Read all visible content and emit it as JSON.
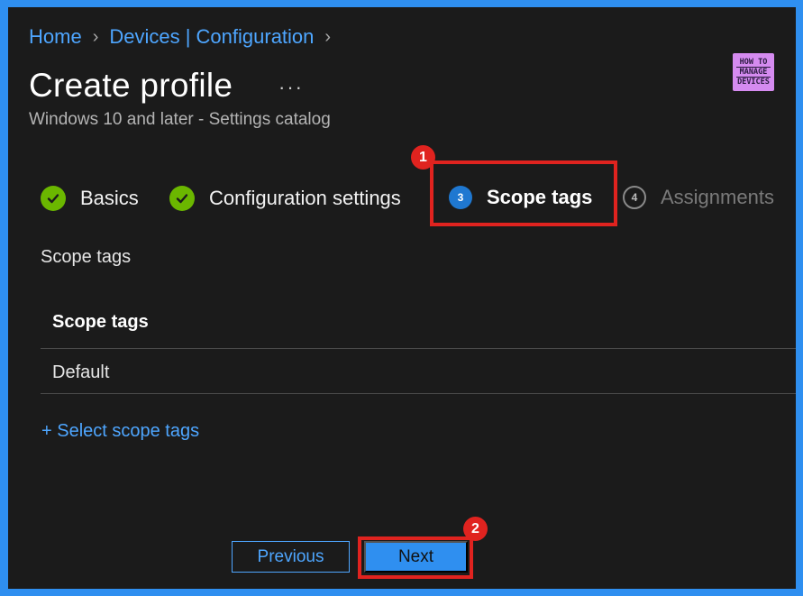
{
  "breadcrumb": {
    "items": [
      "Home",
      "Devices | Configuration"
    ]
  },
  "header": {
    "title": "Create profile",
    "more": "···",
    "subtitle": "Windows 10 and later - Settings catalog"
  },
  "logo": {
    "line1": "HOW TO",
    "line2": "MANAGE",
    "line3": "DEVICES"
  },
  "wizard": {
    "steps": [
      {
        "label": "Basics",
        "state": "done"
      },
      {
        "label": "Configuration settings",
        "state": "done"
      },
      {
        "number": "3",
        "label": "Scope tags",
        "state": "current"
      },
      {
        "number": "4",
        "label": "Assignments",
        "state": "todo"
      }
    ]
  },
  "annotations": {
    "badge1": "1",
    "badge2": "2",
    "color": "#e0231f"
  },
  "content": {
    "section_label": "Scope tags",
    "table": {
      "header": "Scope tags",
      "rows": [
        "Default"
      ]
    },
    "select_link": "+ Select scope tags"
  },
  "footer": {
    "previous": "Previous",
    "next": "Next"
  },
  "colors": {
    "accent": "#2f8ff0",
    "success": "#6bb700",
    "background": "#1b1b1b"
  }
}
